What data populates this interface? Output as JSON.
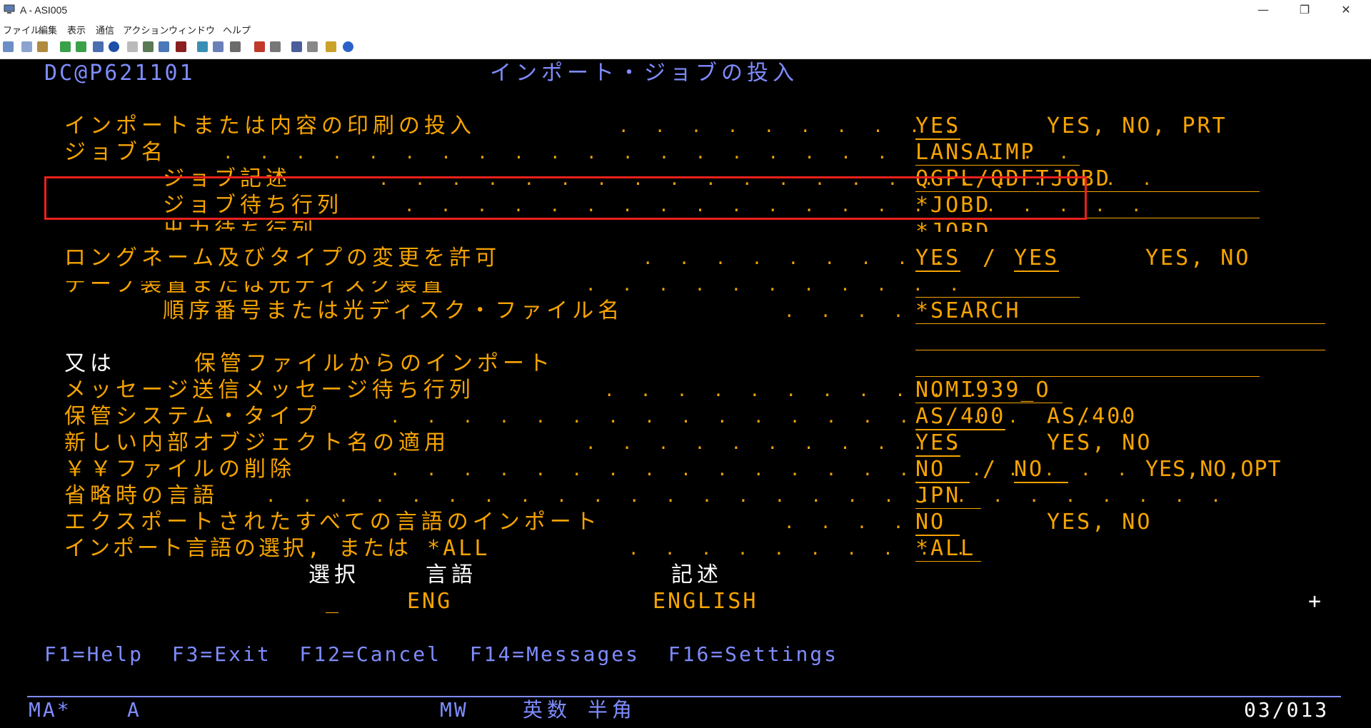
{
  "window": {
    "title": "A - ASI005"
  },
  "window_controls": {
    "minimize": "—",
    "restore": "❐",
    "close": "✕"
  },
  "menu": [
    "ファイル",
    "編集",
    "表示",
    "通信",
    "アクション",
    "ウィンドウ",
    "ヘルプ"
  ],
  "toolbar_icons": [
    "copy-icon",
    "paste-icon",
    "print-icon",
    "send-icon",
    "receive-icon",
    "macro-icon",
    "map-icon",
    "record-icon",
    "play-icon",
    "stop-icon",
    "keypad-icon",
    "settings-icon",
    "tools-icon",
    "transfer-icon",
    "log-icon",
    "help-icon"
  ],
  "header": {
    "screen_id": "DC@P621101",
    "title": "インポート・ジョブの投入"
  },
  "rows": [
    {
      "label": "インポートまたは内容の印刷の投入",
      "value": "YES",
      "hint": "YES, NO, PRT"
    },
    {
      "label": "ジョブ名",
      "value": "LANSAIMP"
    },
    {
      "label": "ジョブ記述",
      "value": "QGPL/QDFTJOBD"
    },
    {
      "label": "ジョブ待ち行列",
      "value": "*JOBD"
    },
    {
      "label": "出力待ち行列",
      "value": "*JOBD"
    },
    {
      "label": "ロングネーム及びタイプの変更を許可",
      "value": "YES",
      "value2": "YES",
      "sep": "/",
      "hint": "YES, NO"
    },
    {
      "label": "テープ装置または光ディスク装置",
      "value": ""
    },
    {
      "label": "順序番号または光ディスク・ファイル名",
      "value": "*SEARCH"
    },
    {
      "label": "又は",
      "label2": "保管ファイルからのインポート",
      "value": ""
    },
    {
      "label": "メッセージ送信メッセージ待ち行列",
      "value": "NOMI939_O"
    },
    {
      "label": "保管システム・タイプ",
      "value": "AS/400",
      "hint": "AS/400"
    },
    {
      "label": "新しい内部オブジェクト名の適用",
      "value": "YES",
      "hint": "YES, NO"
    },
    {
      "label": "￥￥ファイルの削除",
      "value": "NO",
      "value2": "NO",
      "sep": "/",
      "hint": "YES,NO,OPT"
    },
    {
      "label": "省略時の言語",
      "value": "JPN"
    },
    {
      "label": "エクスポートされたすべての言語のインポート",
      "value": "NO",
      "hint": "YES, NO"
    },
    {
      "label": "インポート言語の選択, または *ALL",
      "value": "*ALL"
    }
  ],
  "language_table": {
    "headers": {
      "select": "選択",
      "language": "言語",
      "description": "記述"
    },
    "rows": [
      {
        "select": "_",
        "language": "ENG",
        "description": "ENGLISH"
      }
    ],
    "more": "+"
  },
  "function_keys": "F1=Help  F3=Exit  F12=Cancel  F14=Messages  F16=Settings",
  "status": {
    "left": "MA*",
    "session": "A",
    "mode": "MW",
    "ime": "英数 半角",
    "cursor": "03/013"
  },
  "colors": {
    "label": "#f7a400",
    "heading": "#7f8cff",
    "plain": "#ffffff",
    "highlight_box": "#e8211c"
  }
}
